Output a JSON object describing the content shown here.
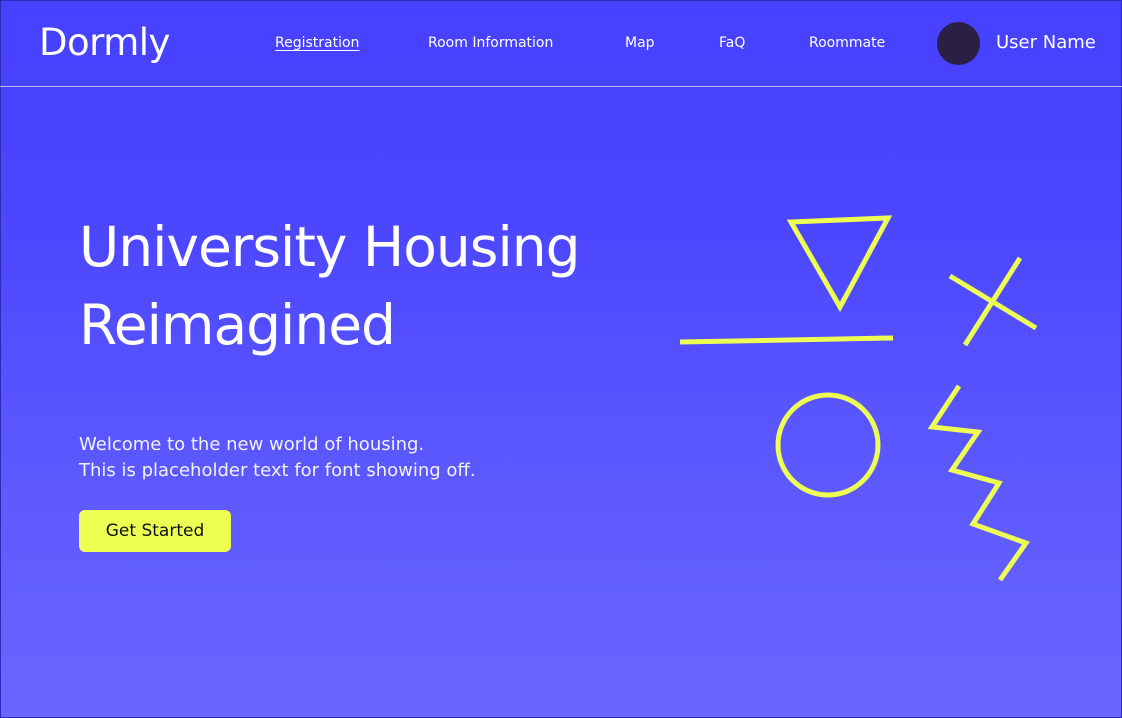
{
  "header": {
    "logo": "Dormly",
    "nav": [
      {
        "label": "Registration",
        "active": true
      },
      {
        "label": "Room Information",
        "active": false
      },
      {
        "label": "Map",
        "active": false
      },
      {
        "label": "FaQ",
        "active": false
      },
      {
        "label": "Roommate",
        "active": false
      }
    ],
    "user_name": "User Name"
  },
  "hero": {
    "title_line1": "University Housing",
    "title_line2": "Reimagined",
    "text_line1": "Welcome to the new world of housing.",
    "text_line2": "This is placeholder text for font showing off.",
    "cta_label": "Get Started"
  },
  "colors": {
    "background_top": "#4641ff",
    "background_bottom": "#6966ff",
    "accent": "#ecff52",
    "avatar": "#2a1f44",
    "text": "#ffffff"
  },
  "decorations": [
    "triangle-shape",
    "line-shape",
    "cross-shape",
    "circle-shape",
    "zigzag-shape"
  ]
}
